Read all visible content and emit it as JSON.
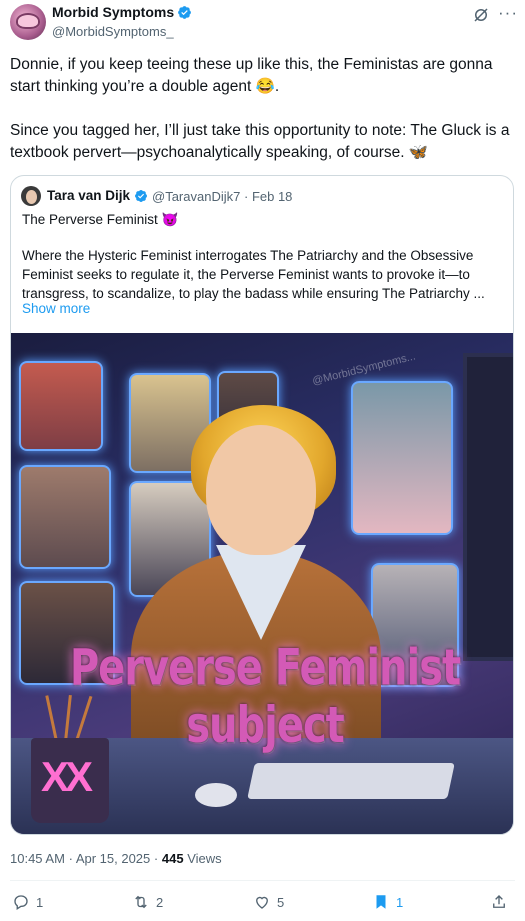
{
  "author": {
    "name": "Morbid Symptoms",
    "handle": "@MorbidSymptoms_"
  },
  "post": {
    "paragraph1": "Donnie, if you keep teeing these up like this, the Feministas are gonna start thinking you’re a double agent 😂.",
    "paragraph2": "Since you tagged her, I’ll just take this opportunity to note: The Gluck is a textbook pervert—psychoanalytically speaking, of course. 🦋"
  },
  "quote": {
    "name": "Tara van Dijk",
    "handle": "@TaravanDijk7",
    "separator": "·",
    "date": "Feb 18",
    "title": "The Perverse Feminist 😈",
    "body": "Where the Hysteric Feminist interrogates The Patriarchy and the Obsessive Feminist seeks to regulate it, the Perverse Feminist wants to provoke it—to transgress, to scandalize, to play the badass while ensuring The Patriarchy ...",
    "show_more": "Show more",
    "image": {
      "caption": "Perverse Feminist subject",
      "watermark": "@MorbidSymptoms...",
      "mug_text": "XX"
    }
  },
  "meta": {
    "time": "10:45 AM",
    "separator": "·",
    "date": "Apr 15, 2025",
    "views_count": "445",
    "views_label": "Views"
  },
  "actions": {
    "reply_count": "1",
    "repost_count": "2",
    "like_count": "5",
    "bookmark_count": "1"
  },
  "colors": {
    "accent": "#1d9bf0",
    "text": "#0f1419",
    "secondary": "#536471",
    "border": "#cfd9de"
  },
  "icons": [
    "verified-badge-icon",
    "grok-icon",
    "more-icon",
    "reply-icon",
    "repost-icon",
    "like-icon",
    "bookmark-icon",
    "share-icon"
  ]
}
